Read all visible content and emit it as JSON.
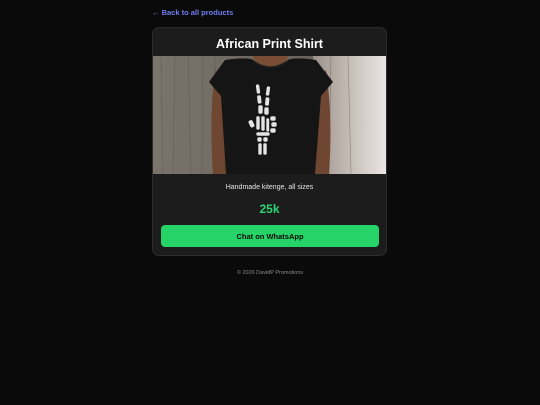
{
  "nav": {
    "back_label": "← Back to all products"
  },
  "product": {
    "title": "African Print Shirt",
    "description": "Handmade kitenge, all sizes",
    "price": "25k",
    "cta_label": "Chat on WhatsApp",
    "image_icon": "skeleton-peace-hand-tshirt-photo"
  },
  "footer": {
    "text": "© 2026 DavidP Promotions"
  },
  "colors": {
    "background": "#0a0a0a",
    "card": "#1c1c1c",
    "link": "#6f7ff0",
    "price": "#2ed573",
    "whatsapp": "#25d366"
  }
}
